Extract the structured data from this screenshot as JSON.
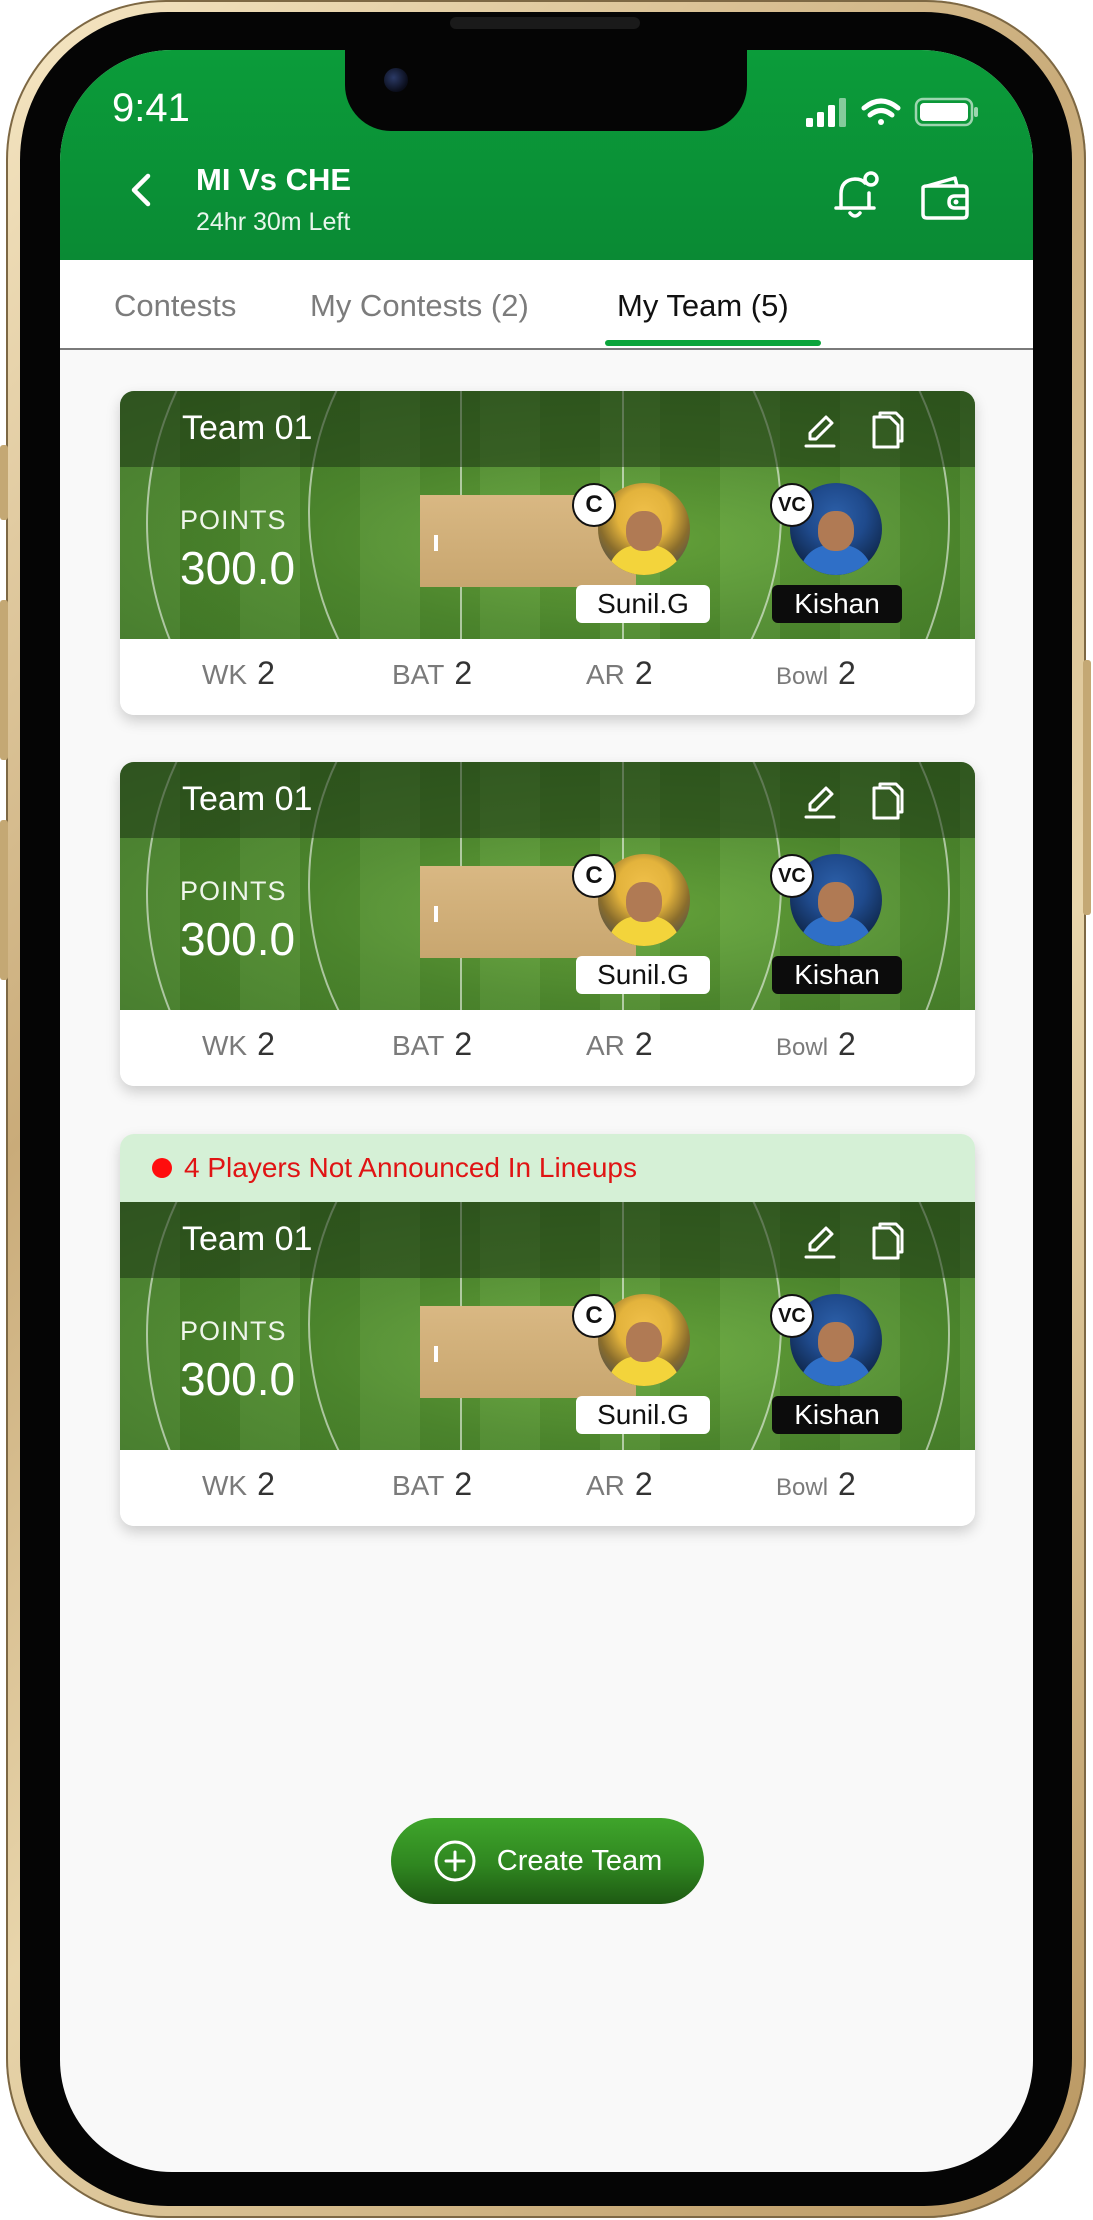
{
  "status_bar": {
    "time": "9:41"
  },
  "header": {
    "title": "MI Vs CHE",
    "subtitle": "24hr 30m Left"
  },
  "tabs": [
    {
      "label": "Contests",
      "active": false
    },
    {
      "label": "My Contests (2)",
      "active": false
    },
    {
      "label": "My Team (5)",
      "active": true
    }
  ],
  "teams": [
    {
      "name": "Team 01",
      "points_label": "POINTS",
      "points": "300.0",
      "captain_badge": "C",
      "captain": "Sunil.G",
      "vice_captain_badge": "VC",
      "vice_captain": "Kishan",
      "stats": [
        {
          "label": "WK",
          "value": "2"
        },
        {
          "label": "BAT",
          "value": "2"
        },
        {
          "label": "AR",
          "value": "2"
        },
        {
          "label": "Bowl",
          "value": "2"
        }
      ]
    },
    {
      "name": "Team 01",
      "points_label": "POINTS",
      "points": "300.0",
      "captain_badge": "C",
      "captain": "Sunil.G",
      "vice_captain_badge": "VC",
      "vice_captain": "Kishan",
      "stats": [
        {
          "label": "WK",
          "value": "2"
        },
        {
          "label": "BAT",
          "value": "2"
        },
        {
          "label": "AR",
          "value": "2"
        },
        {
          "label": "Bowl",
          "value": "2"
        }
      ]
    },
    {
      "alert": "4 Players Not Announced In Lineups",
      "name": "Team 01",
      "points_label": "POINTS",
      "points": "300.0",
      "captain_badge": "C",
      "captain": "Sunil.G",
      "vice_captain_badge": "VC",
      "vice_captain": "Kishan",
      "stats": [
        {
          "label": "WK",
          "value": "2"
        },
        {
          "label": "BAT",
          "value": "2"
        },
        {
          "label": "AR",
          "value": "2"
        },
        {
          "label": "Bowl",
          "value": "2"
        }
      ]
    }
  ],
  "create_button": {
    "label": "Create Team"
  },
  "colors": {
    "header": "#0b9c3a",
    "accent": "#0ba43b",
    "alert_bg": "#d5f0d6",
    "alert_text": "#e01414"
  },
  "icons": [
    "back-arrow-icon",
    "bell-icon",
    "wallet-icon",
    "edit-icon",
    "copy-icon",
    "plus-circle-icon",
    "signal-icon",
    "wifi-icon",
    "battery-icon"
  ]
}
